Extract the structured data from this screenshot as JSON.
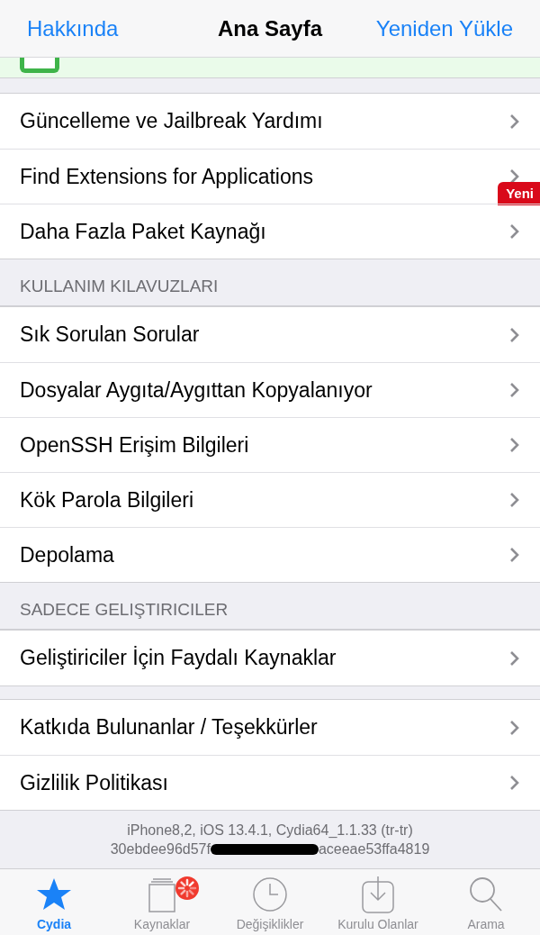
{
  "nav": {
    "left": "Hakkında",
    "title": "Ana Sayfa",
    "right": "Yeniden Yükle"
  },
  "sections": [
    {
      "items": [
        {
          "label": "Güncelleme ve Jailbreak Yardımı"
        },
        {
          "label": "Find Extensions for Applications",
          "badge": "Yeni"
        },
        {
          "label": "Daha Fazla Paket Kaynağı"
        }
      ]
    },
    {
      "header": "KULLANIM KILAVUZLARI",
      "items": [
        {
          "label": "Sık Sorulan Sorular"
        },
        {
          "label": "Dosyalar Aygıta/Aygıttan Kopyalanıyor"
        },
        {
          "label": "OpenSSH Erişim Bilgileri"
        },
        {
          "label": "Kök Parola Bilgileri"
        },
        {
          "label": "Depolama"
        }
      ]
    },
    {
      "header": "SADECE GELIŞTIRICILER",
      "items": [
        {
          "label": "Geliştiriciler İçin Faydalı Kaynaklar"
        }
      ]
    },
    {
      "items": [
        {
          "label": "Katkıda Bulunanlar / Teşekkürler"
        },
        {
          "label": "Gizlilik Politikası"
        }
      ]
    }
  ],
  "footer": {
    "line1": "iPhone8,2, iOS 13.4.1, Cydia64_1.1.33 (tr-tr)",
    "line2_start": "30ebdee96d57f",
    "line2_end": "aceeae53ffa4819"
  },
  "tabs": [
    {
      "label": "Cydia",
      "kind": "star",
      "selected": true,
      "loading": false
    },
    {
      "label": "Kaynaklar",
      "kind": "stack",
      "selected": false,
      "loading": true
    },
    {
      "label": "Değişiklikler",
      "kind": "clock",
      "selected": false,
      "loading": false
    },
    {
      "label": "Kurulu Olanlar",
      "kind": "download",
      "selected": false,
      "loading": false
    },
    {
      "label": "Arama",
      "kind": "search",
      "selected": false,
      "loading": false
    }
  ]
}
